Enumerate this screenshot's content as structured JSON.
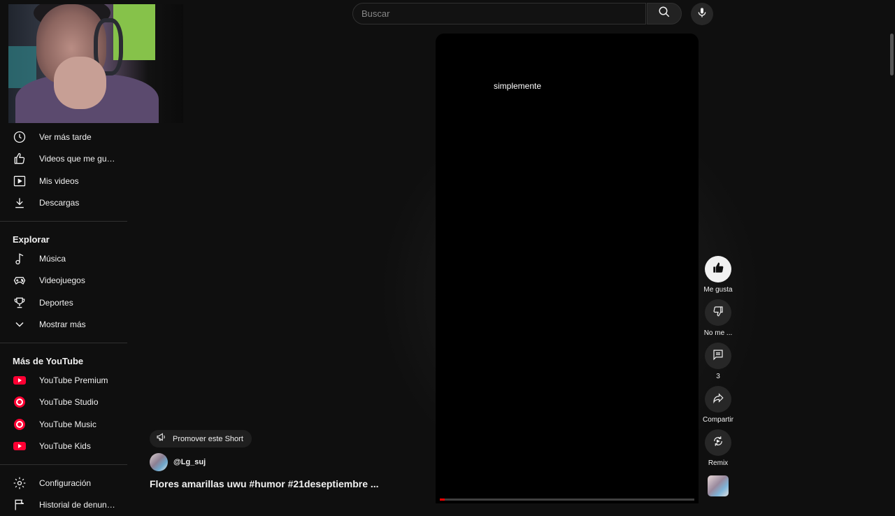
{
  "search": {
    "placeholder": "Buscar"
  },
  "sidebar": {
    "library": [
      {
        "label": "Ver más tarde",
        "icon": "clock-icon"
      },
      {
        "label": "Videos que me gus...",
        "icon": "thumbs-up-icon"
      },
      {
        "label": "Mis videos",
        "icon": "play-square-icon"
      },
      {
        "label": "Descargas",
        "icon": "download-icon"
      }
    ],
    "explore_title": "Explorar",
    "explore": [
      {
        "label": "Música",
        "icon": "music-note-icon"
      },
      {
        "label": "Videojuegos",
        "icon": "gamepad-icon"
      },
      {
        "label": "Deportes",
        "icon": "trophy-icon"
      },
      {
        "label": "Mostrar más",
        "icon": "chevron-down-icon"
      }
    ],
    "more_title": "Más de YouTube",
    "more": [
      {
        "label": "YouTube Premium",
        "icon": "youtube-premium-icon"
      },
      {
        "label": "YouTube Studio",
        "icon": "youtube-studio-icon"
      },
      {
        "label": "YouTube Music",
        "icon": "youtube-music-icon"
      },
      {
        "label": "YouTube Kids",
        "icon": "youtube-kids-icon"
      }
    ],
    "bottom": [
      {
        "label": "Configuración",
        "icon": "gear-icon"
      },
      {
        "label": "Historial de denunc...",
        "icon": "flag-icon"
      }
    ]
  },
  "video": {
    "caption": "simplemente",
    "progress": 0.02
  },
  "actions": {
    "like_label": "Me gusta",
    "dislike_label": "No me ...",
    "comments_count": "3",
    "share_label": "Compartir",
    "remix_label": "Remix"
  },
  "info": {
    "promote_label": "Promover este Short",
    "channel_handle": "@Lg_suj",
    "title": "Flores amarillas uwu #humor #21deseptiembre ..."
  },
  "colors": {
    "background": "#0f0f0f",
    "accent": "#ff0000"
  }
}
